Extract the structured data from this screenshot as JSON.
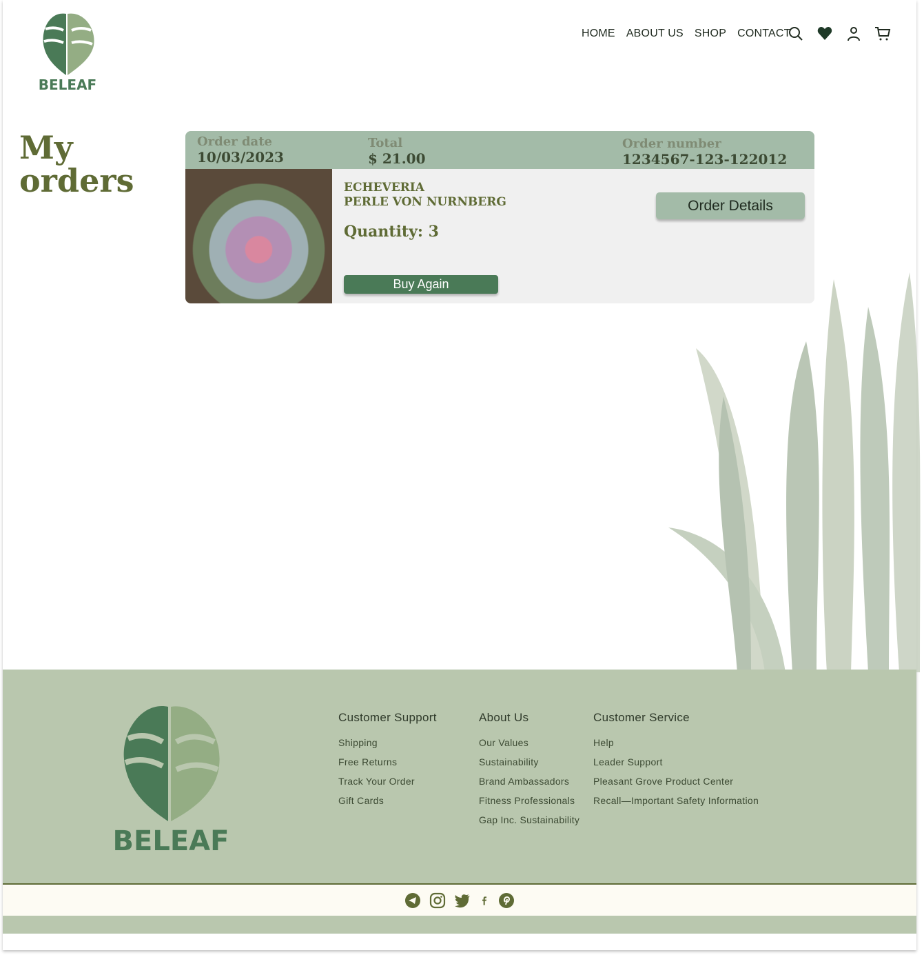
{
  "brand": {
    "name": "BELEAF",
    "colors": {
      "dark_green": "#4a7a57",
      "light_green": "#94ad84",
      "olive": "#5f6b35",
      "sage": "#a3bba8",
      "footer": "#b9c7ae"
    }
  },
  "nav": {
    "items": [
      "HOME",
      "ABOUT US",
      "SHOP",
      "CONTACT"
    ],
    "icons": [
      "search-icon",
      "heart-icon",
      "user-icon",
      "cart-icon"
    ]
  },
  "page": {
    "title_line1": "My",
    "title_line2": "orders"
  },
  "order": {
    "date_label": "Order date",
    "date": "10/03/2023",
    "total_label": "Total",
    "total": "$ 21.00",
    "number_label": "Order number",
    "number": "1234567-123-122012",
    "product_line1": "ECHEVERIA",
    "product_line2": "PERLE VON NURNBERG",
    "quantity": "Quantity: 3",
    "buy_again": "Buy Again",
    "order_details": "Order Details"
  },
  "footer": {
    "columns": [
      {
        "title": "Customer Support",
        "links": [
          "Shipping",
          "Free Returns",
          "Track Your Order",
          "Gift Cards"
        ]
      },
      {
        "title": "About Us",
        "links": [
          "Our Values",
          "Sustainability",
          "Brand Ambassadors",
          "Fitness Professionals",
          "Gap Inc. Sustainability"
        ]
      },
      {
        "title": "Customer Service",
        "links": [
          "Help",
          "Leader Support",
          "Pleasant Grove Product Center",
          "Recall—Important Safety Information"
        ]
      }
    ],
    "social": [
      "telegram-icon",
      "instagram-icon",
      "twitter-icon",
      "facebook-icon",
      "pinterest-icon"
    ]
  }
}
